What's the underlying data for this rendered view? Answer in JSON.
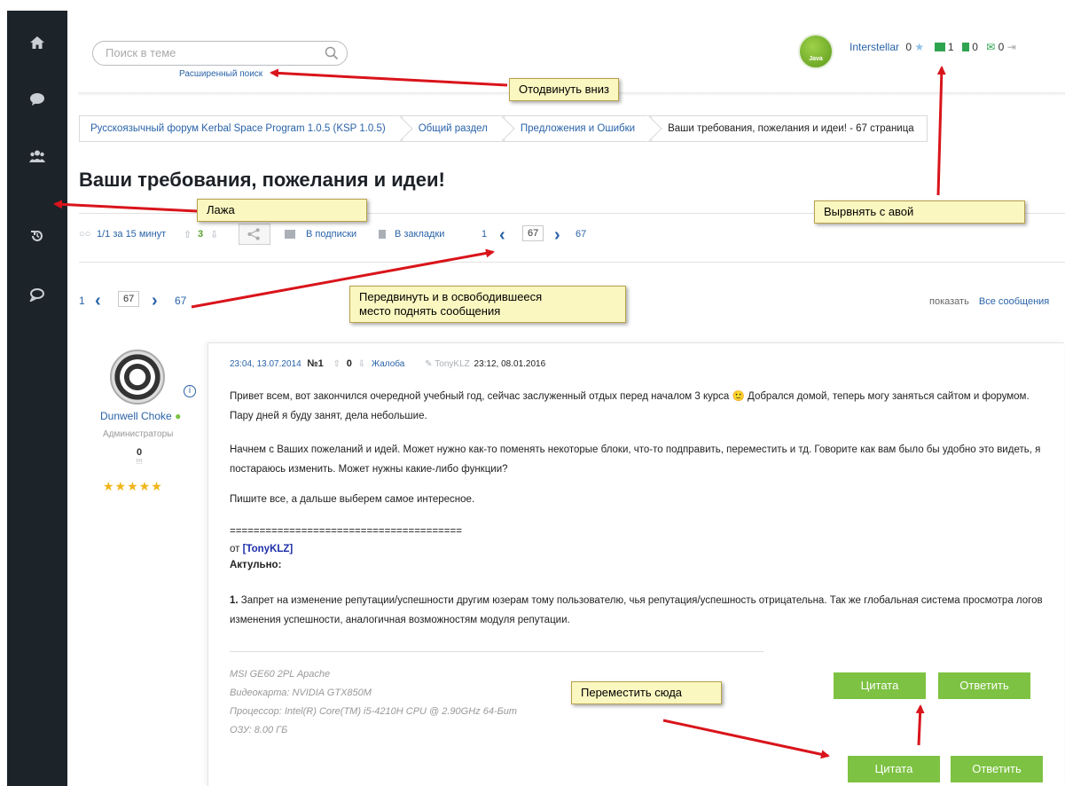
{
  "search": {
    "placeholder": "Поиск в теме",
    "advanced_link": "Расширенный поиск"
  },
  "user": {
    "avatar_text": "Java",
    "name": "Interstellar",
    "rep": "0",
    "count1": "1",
    "count2": "0",
    "count3": "0"
  },
  "breadcrumb": [
    "Русскоязычный форум Kerbal Space Program 1.0.5 (KSP 1.0.5)",
    "Общий раздел",
    "Предложения и Ошибки",
    "Ваши требования, пожелания и идеи! - 67 страница"
  ],
  "page_title": "Ваши требования, пожелания и идеи!",
  "toolbar": {
    "viewers": "1/1 за 15 минут",
    "rating": "3",
    "subscribe": "В подписки",
    "bookmarks": "В закладки",
    "page_first": "1",
    "page_current": "67",
    "page_last": "67"
  },
  "pager2": {
    "page_first": "1",
    "page_current": "67",
    "page_last": "67",
    "show_label": "показать",
    "show_all": "Все сообщения"
  },
  "author": {
    "name": "Dunwell Choke",
    "group": "Администраторы",
    "rep": "0",
    "rep_sub": "!!!",
    "stars": "★★★★★"
  },
  "post": {
    "datetime": "23:04, 13.07.2014",
    "number": "№1",
    "rating": "0",
    "complaint": "Жалоба",
    "edited_by": "TonyKLZ",
    "edited_at": "23:12, 08.01.2016",
    "p1": "Привет всем, вот закончился очередной учебный год, сейчас заслуженный отдых перед началом 3 курса  🙂  Добрался домой, теперь могу заняться сайтом и форумом. Пару дней я буду занят, дела небольшие.",
    "p2": "Начнем с Ваших пожеланий и идей. Может нужно как-то поменять некоторые блоки, что-то подправить, переместить и тд. Говорите как вам было бы удобно это видеть, я постараюсь изменить. Может нужны какие-либо функции?",
    "p3": "Пишите все, а дальше выберем самое интересное.",
    "divider": "=======================================",
    "from_label": "от",
    "from_user": "[TonyKLZ]",
    "actual": "Актульно:",
    "item_num": "1.",
    "item_text": "Запрет на изменение репутации/успешности другим юзерам тому пользователю, чья репутация/успешность отрицательна. Так же глобальная система просмотра логов изменения успешности, аналогичная возможностям модуля репутации."
  },
  "signature": [
    "MSI GE60 2PL Apache",
    "Видеокарта: NVIDIA GTX850M",
    "Процессор: Intel(R) Core(TM) i5-4210H CPU @ 2.90GHz 64-Бит",
    "ОЗУ: 8.00 ГБ"
  ],
  "buttons": {
    "quote": "Цитата",
    "reply": "Ответить"
  },
  "notes": {
    "move_down": "Отодвинуть вниз",
    "lazha": "Лажа",
    "align_avatar": "Вырвнять с авой",
    "move_pager_1": "Передвинуть и в освободившееся",
    "move_pager_2": "место поднять сообщения",
    "move_here": "Переместить сюда"
  },
  "colors": {
    "sidebar": "#1c2329",
    "link": "#2a63a8",
    "button_green": "#7dc242",
    "note_bg": "#fbf7c0",
    "arrow_red": "#d9141b"
  }
}
